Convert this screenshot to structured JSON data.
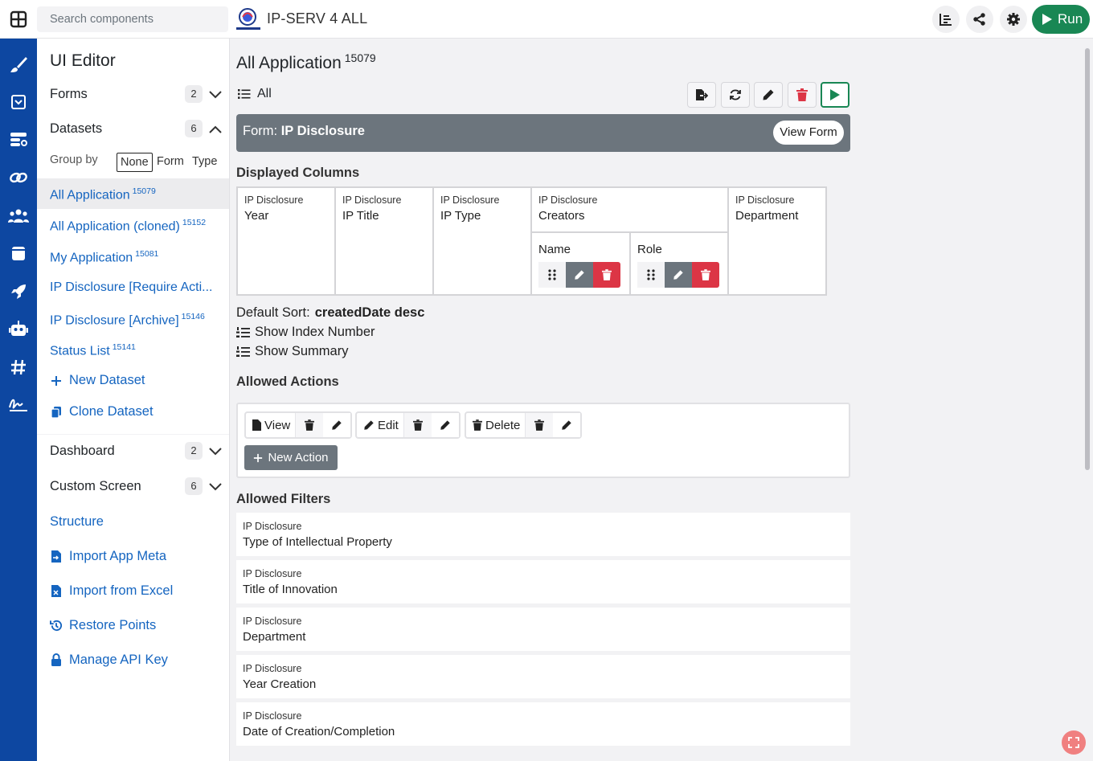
{
  "topbar": {
    "search_placeholder": "Search components",
    "app_title": "IP-SERV 4 ALL",
    "run_label": "Run"
  },
  "sidebar": {
    "title": "UI Editor",
    "sections": {
      "forms": {
        "label": "Forms",
        "count": "2"
      },
      "datasets": {
        "label": "Datasets",
        "count": "6"
      },
      "dashboard": {
        "label": "Dashboard",
        "count": "2"
      },
      "custom_screen": {
        "label": "Custom Screen",
        "count": "6"
      }
    },
    "group_by": {
      "label": "Group by",
      "options": [
        "None",
        "Form",
        "Type"
      ],
      "selected": "None"
    },
    "datasets": [
      {
        "label": "All Application",
        "id": "15079"
      },
      {
        "label": "All Application (cloned)",
        "id": "15152"
      },
      {
        "label": "My Application",
        "id": "15081"
      },
      {
        "label": "IP Disclosure [Require Acti...",
        "id": ""
      },
      {
        "label": "IP Disclosure [Archive]",
        "id": "15146"
      },
      {
        "label": "Status List",
        "id": "15141"
      }
    ],
    "new_dataset": "New Dataset",
    "clone_dataset": "Clone Dataset",
    "links": {
      "structure": "Structure",
      "import_meta": "Import App Meta",
      "import_excel": "Import from Excel",
      "restore": "Restore Points",
      "api_key": "Manage API Key"
    }
  },
  "main": {
    "title": "All Application",
    "title_id": "15079",
    "view_label": "All",
    "form_prefix": "Form:",
    "form_name": "IP Disclosure",
    "view_form": "View Form",
    "displayed_columns_title": "Displayed Columns",
    "columns": [
      {
        "source": "IP Disclosure",
        "name": "Year"
      },
      {
        "source": "IP Disclosure",
        "name": "IP Title"
      },
      {
        "source": "IP Disclosure",
        "name": "IP Type"
      },
      {
        "source": "IP Disclosure",
        "name": "Creators",
        "children": [
          "Name",
          "Role"
        ]
      },
      {
        "source": "IP Disclosure",
        "name": "Department"
      }
    ],
    "default_sort_label": "Default Sort:",
    "default_sort_value": "createdDate desc",
    "show_index": "Show Index Number",
    "show_summary": "Show Summary",
    "allowed_actions_title": "Allowed Actions",
    "actions": [
      "View",
      "Edit",
      "Delete"
    ],
    "new_action": "New Action",
    "allowed_filters_title": "Allowed Filters",
    "filters": [
      {
        "source": "IP Disclosure",
        "name": "Type of Intellectual Property"
      },
      {
        "source": "IP Disclosure",
        "name": "Title of Innovation"
      },
      {
        "source": "IP Disclosure",
        "name": "Department"
      },
      {
        "source": "IP Disclosure",
        "name": "Year Creation"
      },
      {
        "source": "IP Disclosure",
        "name": "Date of Creation/Completion"
      }
    ]
  },
  "colors": {
    "rail": "#0d47a1",
    "link": "#1565c0",
    "run": "#198754",
    "danger": "#dc3545",
    "form_bar": "#6c757d"
  }
}
